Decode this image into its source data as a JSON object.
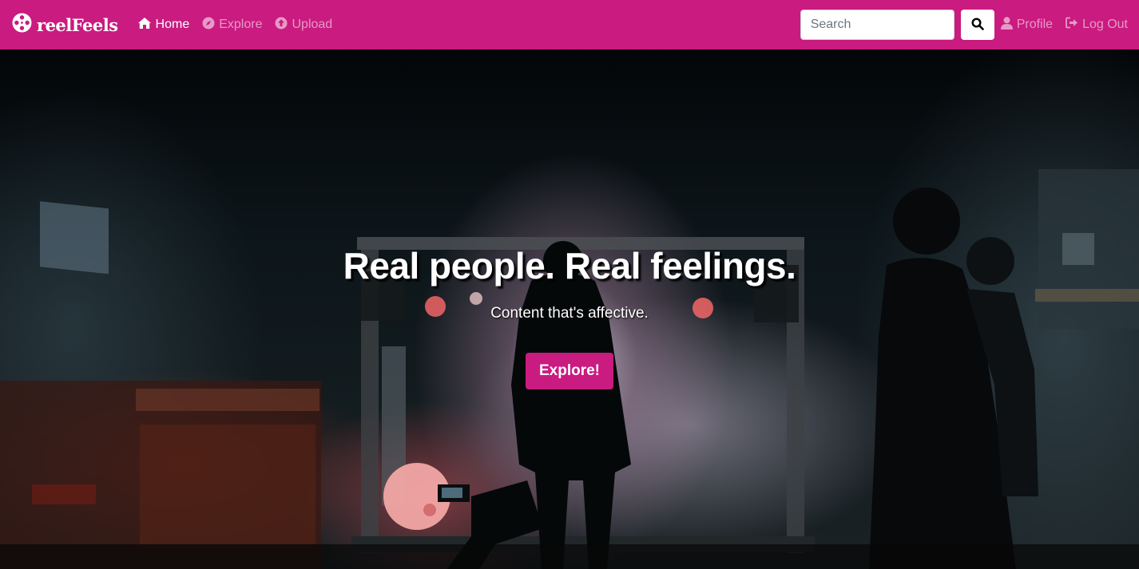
{
  "brand": {
    "name": "reelFeels",
    "icon": "film-reel-icon"
  },
  "nav": {
    "items": [
      {
        "label": "Home",
        "icon": "home-icon",
        "active": true
      },
      {
        "label": "Explore",
        "icon": "compass-icon",
        "active": false
      },
      {
        "label": "Upload",
        "icon": "upload-circle-icon",
        "active": false
      }
    ]
  },
  "search": {
    "placeholder": "Search",
    "button_icon": "search-icon"
  },
  "user_nav": {
    "profile_label": "Profile",
    "profile_icon": "user-icon",
    "logout_label": "Log Out",
    "logout_icon": "sign-out-icon"
  },
  "hero": {
    "title": "Real people. Real feelings.",
    "subtitle": "Content that's affective.",
    "button_label": "Explore!"
  },
  "colors": {
    "brand": "#c91b80",
    "nav_text_active": "#ffffff",
    "nav_text_muted": "#e79ac6"
  }
}
